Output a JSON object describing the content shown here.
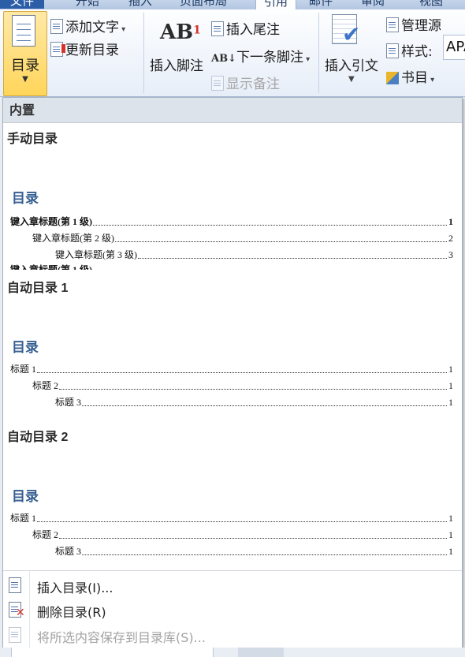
{
  "tabs": [
    "文件",
    "开始",
    "插入",
    "页面布局",
    "引用",
    "邮件",
    "审阅",
    "视图"
  ],
  "ribbon": {
    "toc_button": "目录",
    "add_text": "添加文字",
    "update_toc": "更新目录",
    "insert_footnote": "插入脚注",
    "footnote_icon_text": "AB",
    "footnote_icon_sup": "1",
    "insert_endnote": "插入尾注",
    "next_footnote": "下一条脚注",
    "show_notes": "显示备注",
    "insert_citation": "插入引文",
    "manage_sources": "管理源",
    "style_label": "样式:",
    "style_value": "APA",
    "bibliography": "书目"
  },
  "gallery": {
    "section_header": "内置",
    "templates": [
      {
        "title": "手动目录",
        "heading": "目录",
        "lines": [
          {
            "text": "键入章标题(第 1 级)",
            "page": "1"
          },
          {
            "text": "键入章标题(第 2 级)",
            "page": "2"
          },
          {
            "text": "键入章标题(第 3 级)",
            "page": "3"
          }
        ]
      },
      {
        "title": "自动目录 1",
        "heading": "目录",
        "lines": [
          {
            "text": "标题 1",
            "page": "1"
          },
          {
            "text": "标题 2",
            "page": "1"
          },
          {
            "text": "标题 3",
            "page": "1"
          }
        ]
      },
      {
        "title": "自动目录 2",
        "heading": "目录",
        "lines": [
          {
            "text": "标题 1",
            "page": "1"
          },
          {
            "text": "标题 2",
            "page": "1"
          },
          {
            "text": "标题 3",
            "page": "1"
          }
        ]
      }
    ]
  },
  "menu": {
    "insert_toc": "插入目录(I)...",
    "remove_toc": "删除目录(R)",
    "save_selection": "将所选内容保存到目录库(S)..."
  }
}
